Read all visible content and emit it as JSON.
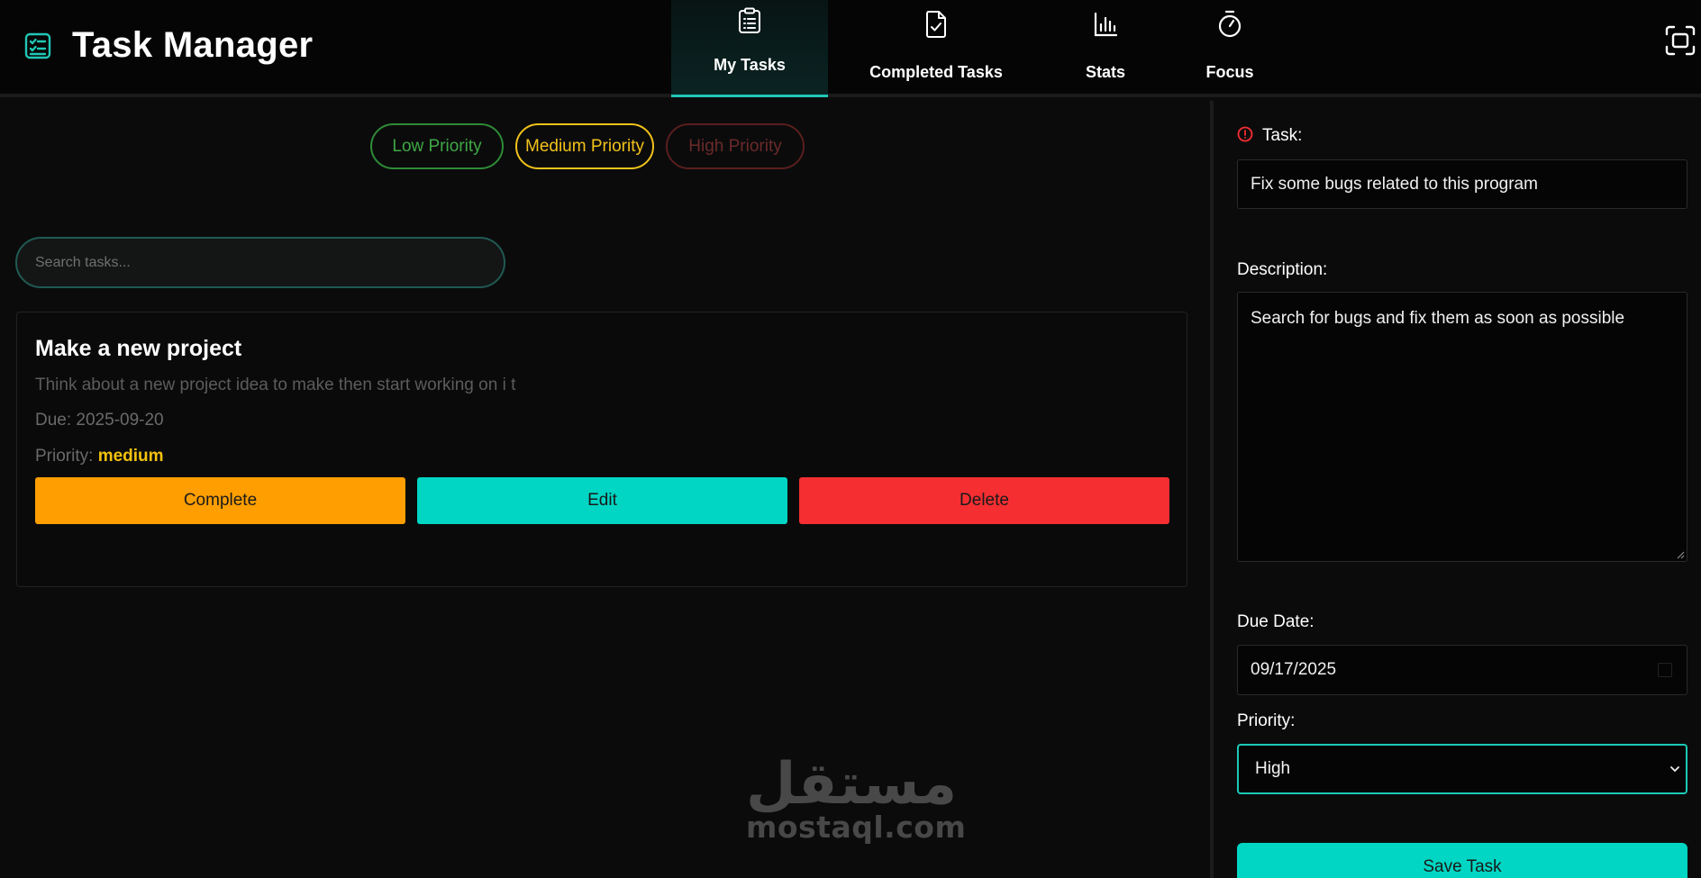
{
  "app": {
    "title": "Task Manager",
    "accent": "#20c7b5"
  },
  "nav": {
    "items": [
      {
        "label": "My Tasks",
        "icon": "clipboard-list-icon",
        "active": true
      },
      {
        "label": "Completed Tasks",
        "icon": "file-check-icon",
        "active": false
      },
      {
        "label": "Stats",
        "icon": "bar-chart-icon",
        "active": false
      },
      {
        "label": "Focus",
        "icon": "stopwatch-icon",
        "active": false
      }
    ],
    "fullscreen_icon": "fullscreen-icon"
  },
  "filters": {
    "low": "Low Priority",
    "medium": "Medium Priority",
    "high": "High Priority",
    "colors": {
      "low": "#3fa845",
      "medium": "#f2c21a",
      "high": "#6b2a2a"
    }
  },
  "search": {
    "placeholder": "Search tasks..."
  },
  "task": {
    "title": "Make a new project",
    "description": "Think about a new project idea to make then start working on i t",
    "due_label": "Due:",
    "due": "2025-09-20",
    "priority_label": "Priority:",
    "priority": "medium",
    "actions": {
      "complete": "Complete",
      "edit": "Edit",
      "delete": "Delete"
    },
    "action_colors": {
      "complete": "#ff9e00",
      "edit": "#00d6c3",
      "delete": "#f52e32"
    }
  },
  "watermark": {
    "arabic": "مستقل",
    "latin": "mostaql.com"
  },
  "form": {
    "task_label": "Task:",
    "task_value": "Fix some bugs related to this program",
    "description_label": "Description:",
    "description_value": "Search for bugs and fix them as soon as possible",
    "due_label": "Due Date:",
    "due_value": "09/17/2025",
    "priority_label": "Priority:",
    "priority_value": "High",
    "save_label": "Save Task"
  }
}
